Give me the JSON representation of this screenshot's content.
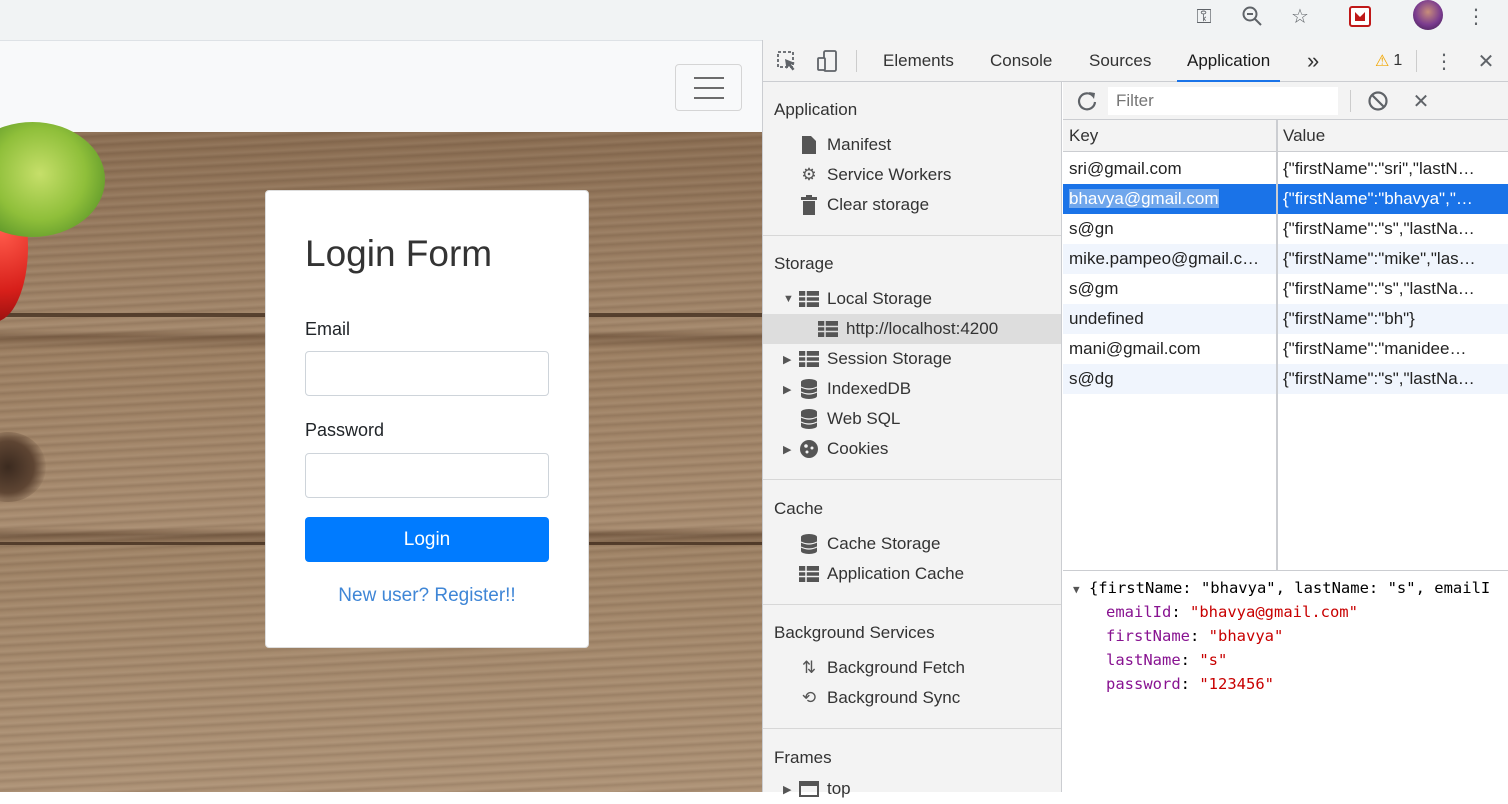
{
  "page": {
    "card_title": "Login Form",
    "email_label": "Email",
    "password_label": "Password",
    "login_button": "Login",
    "register_link": "New user? Register!!"
  },
  "devtools": {
    "tabs": [
      "Elements",
      "Console",
      "Sources",
      "Application"
    ],
    "active_tab": "Application",
    "more_tabs": "»",
    "warning_count": "1",
    "sidebar": {
      "application_section": "Application",
      "application_items": [
        "Manifest",
        "Service Workers",
        "Clear storage"
      ],
      "storage_section": "Storage",
      "local_storage": "Local Storage",
      "local_storage_origin": "http://localhost:4200",
      "session_storage": "Session Storage",
      "indexeddb": "IndexedDB",
      "websql": "Web SQL",
      "cookies": "Cookies",
      "cache_section": "Cache",
      "cache_items": [
        "Cache Storage",
        "Application Cache"
      ],
      "bg_section": "Background Services",
      "bg_items": [
        "Background Fetch",
        "Background Sync"
      ],
      "frames_section": "Frames",
      "frames_top": "top"
    },
    "filter_placeholder": "Filter",
    "columns": {
      "key": "Key",
      "value": "Value"
    },
    "rows": [
      {
        "key": "sri@gmail.com",
        "value": "{\"firstName\":\"sri\",\"lastN…"
      },
      {
        "key": "bhavya@gmail.com",
        "value": "{\"firstName\":\"bhavya\",\"…"
      },
      {
        "key": "s@gn",
        "value": "{\"firstName\":\"s\",\"lastNa…"
      },
      {
        "key": "mike.pampeo@gmail.c…",
        "value": "{\"firstName\":\"mike\",\"las…"
      },
      {
        "key": "s@gm",
        "value": "{\"firstName\":\"s\",\"lastNa…"
      },
      {
        "key": "undefined",
        "value": "{\"firstName\":\"bh\"}"
      },
      {
        "key": "mani@gmail.com",
        "value": "{\"firstName\":\"manidee…"
      },
      {
        "key": "s@dg",
        "value": "{\"firstName\":\"s\",\"lastNa…"
      }
    ],
    "selected_row": 1,
    "preview": {
      "summary": "{firstName: \"bhavya\", lastName: \"s\", emailI",
      "props": [
        {
          "k": "emailId",
          "v": "\"bhavya@gmail.com\""
        },
        {
          "k": "firstName",
          "v": "\"bhavya\""
        },
        {
          "k": "lastName",
          "v": "\"s\""
        },
        {
          "k": "password",
          "v": "\"123456\""
        }
      ]
    }
  }
}
